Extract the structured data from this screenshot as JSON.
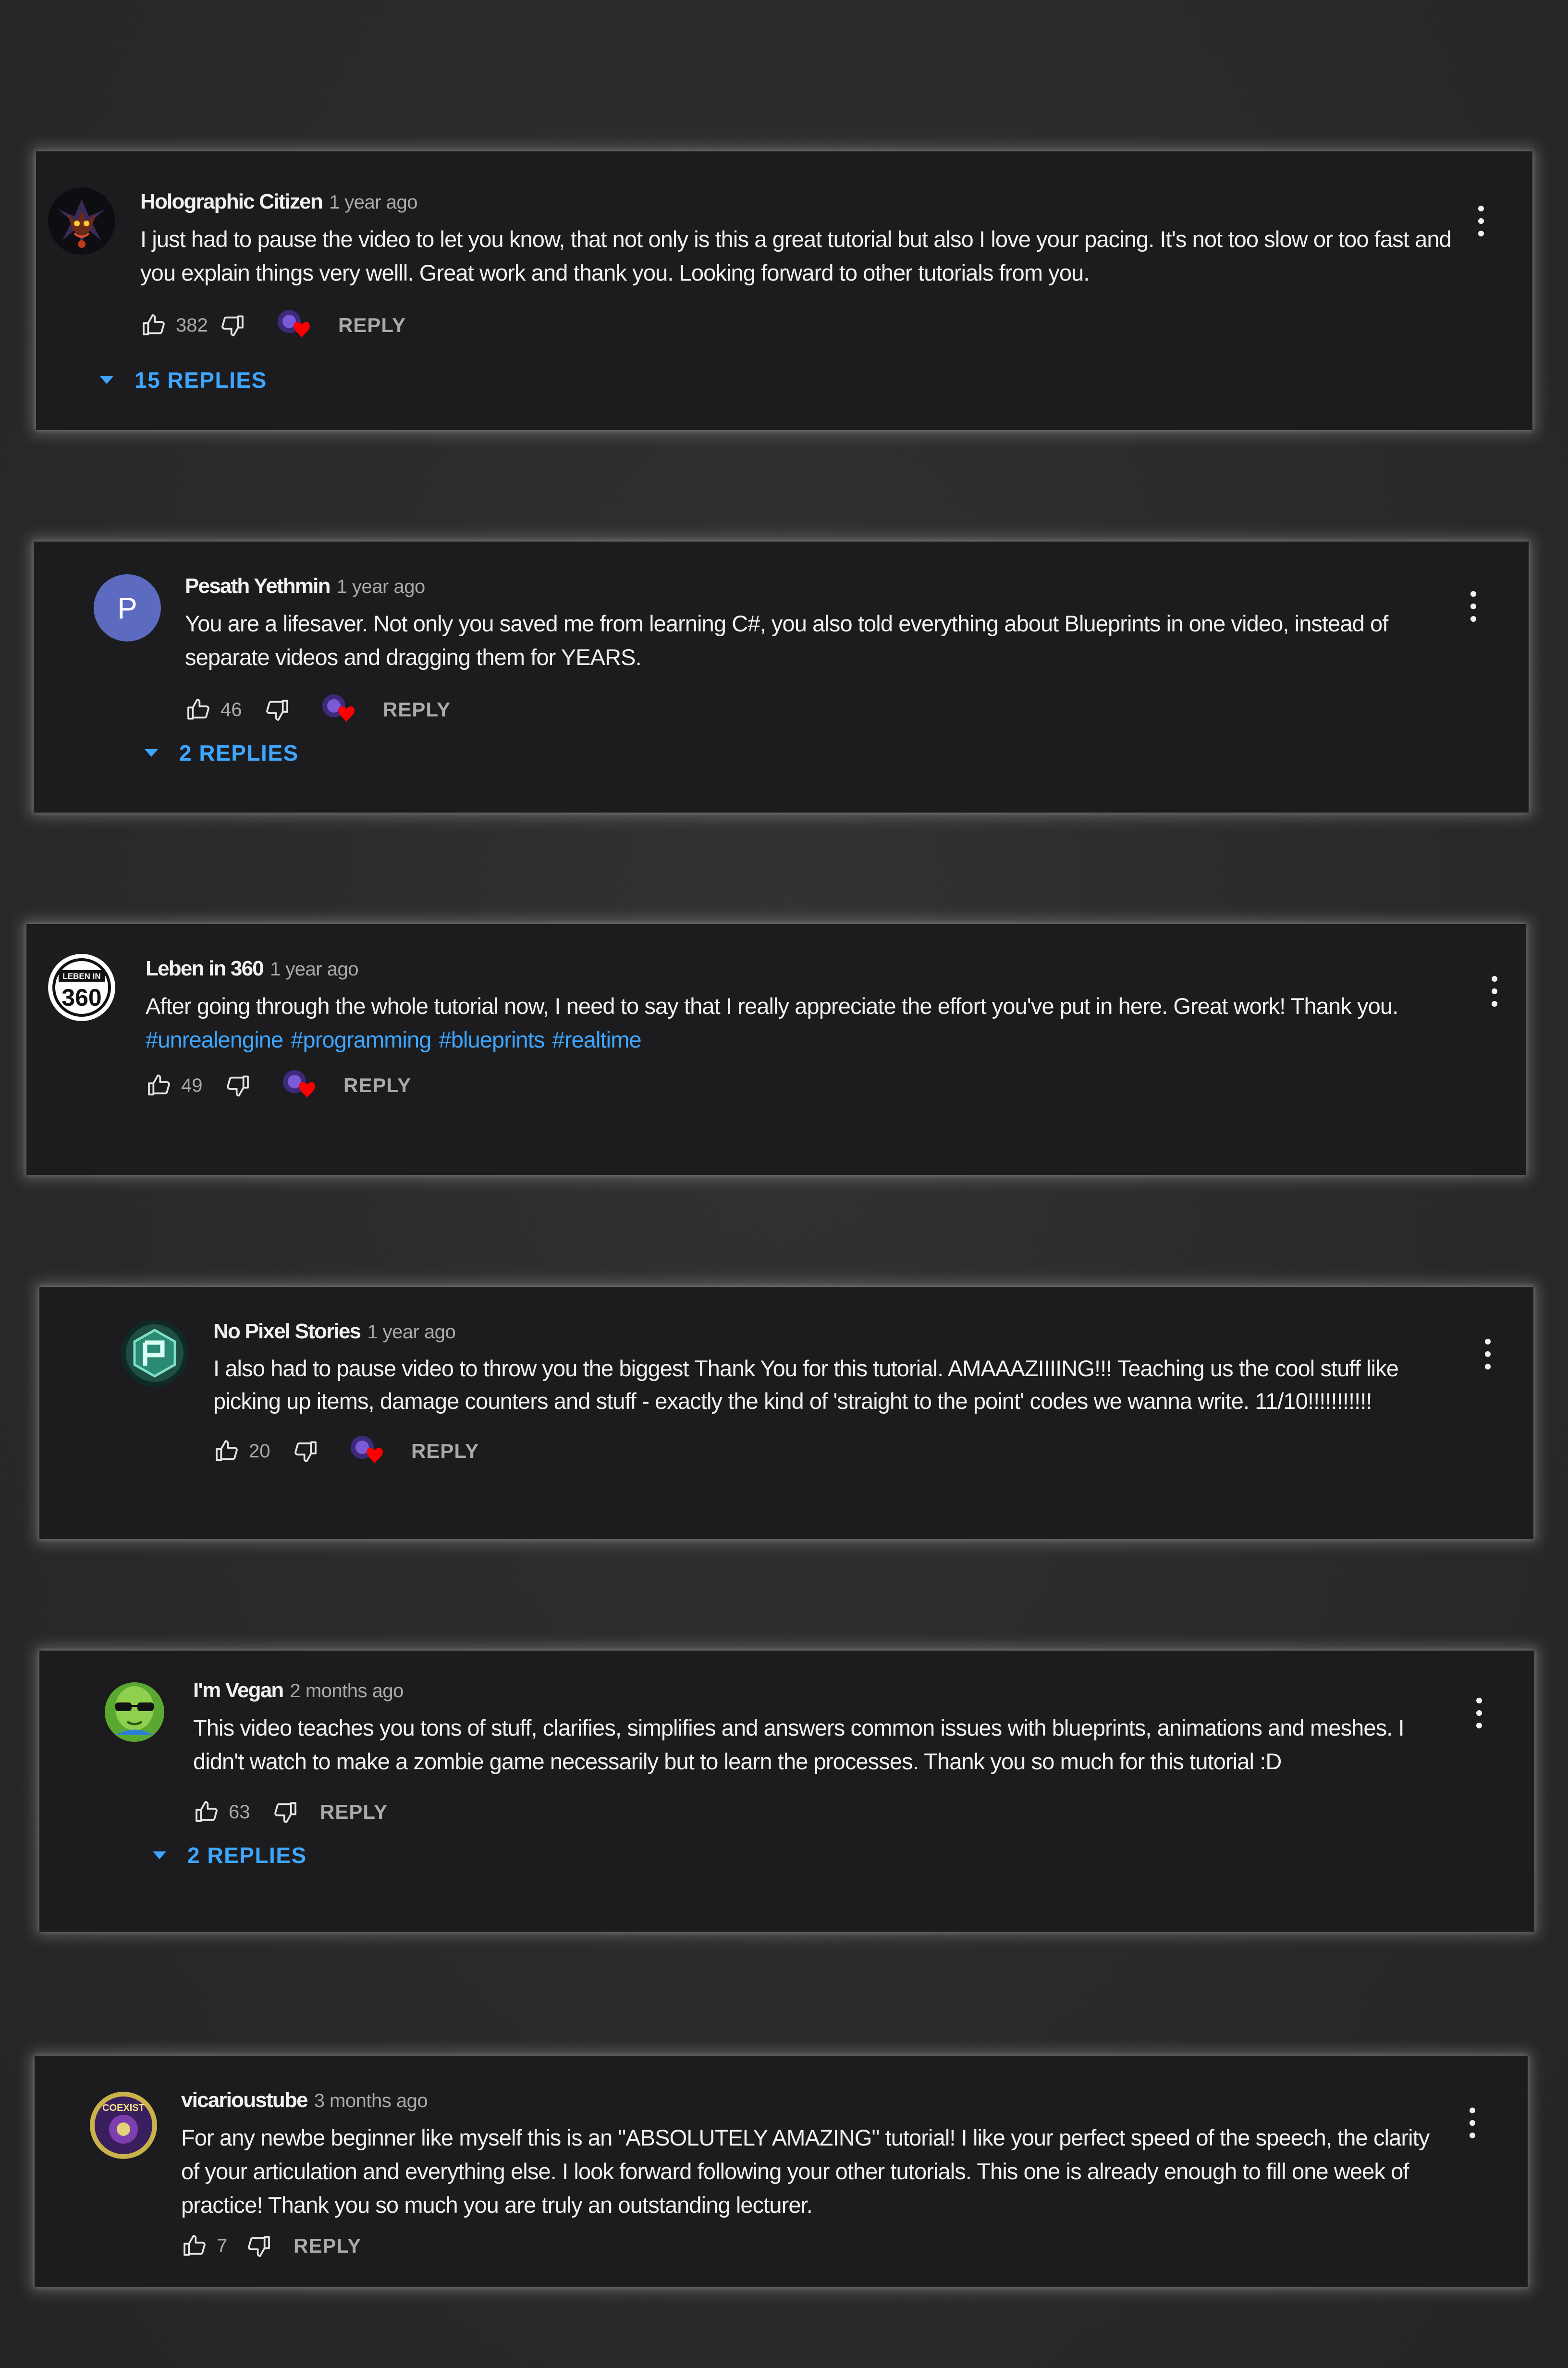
{
  "comments": [
    {
      "author": "Holographic Citizen",
      "time": "1 year ago",
      "text": "I just had to pause the video to let you know, that not only is this a great tutorial but also I love your pacing. It's not too slow or too fast and you explain things very welll. Great work and thank you. Looking forward to other tutorials from you.",
      "likes": "382",
      "reply_label": "REPLY",
      "replies_label": "15 REPLIES",
      "avatar_icon": "dark-creature-avatar-icon"
    },
    {
      "author": "Pesath Yethmin",
      "time": "1 year ago",
      "text": "You are a lifesaver. Not only you saved me from learning C#, you also told everything about Blueprints in one video, instead of separate videos and dragging them for YEARS.",
      "likes": "46",
      "reply_label": "REPLY",
      "replies_label": "2 REPLIES",
      "avatar_letter": "P",
      "avatar_color": "#5c6bc0"
    },
    {
      "author": "Leben in 360",
      "time": "1 year ago",
      "text": "After going through the whole tutorial now, I need to say that I really appreciate the effort you've put in here. Great work! Thank you.",
      "hashtags": [
        "#unrealengine",
        "#programming",
        "#blueprints",
        "#realtime"
      ],
      "likes": "49",
      "reply_label": "REPLY",
      "avatar_logo_top": "LEBEN IN",
      "avatar_logo_bottom": "360"
    },
    {
      "author": "No Pixel Stories",
      "time": "1 year ago",
      "text": "I also had to pause video to throw you the biggest Thank You for this tutorial. AMAAAZIIIING!!! Teaching us the cool stuff like picking up items, damage counters and stuff - exactly the kind of 'straight to the point' codes we wanna write. 11/10!!!!!!!!!!!",
      "likes": "20",
      "reply_label": "REPLY",
      "avatar_icon": "teal-cube-logo-icon"
    },
    {
      "author": "I'm Vegan",
      "time": "2 months ago",
      "text": "This video teaches you tons of stuff, clarifies, simplifies and answers common issues with blueprints, animations and meshes. I didn't watch to make a zombie game necessarily but to learn the processes. Thank you so much for this tutorial :D",
      "likes": "63",
      "reply_label": "REPLY",
      "replies_label": "2 REPLIES",
      "avatar_icon": "green-alien-icon"
    },
    {
      "author": "vicarioustube",
      "time": "3 months ago",
      "text": "For any newbe beginner like myself this is an \"ABSOLUTELY AMAZING\" tutorial! I like your perfect speed of the speech, the clarity of your articulation and everything else. I look forward following your other tutorials. This one is already enough to fill one week of practice! Thank you so much you are truly an outstanding lecturer.",
      "likes": "7",
      "reply_label": "REPLY",
      "avatar_logo_text": "COEXIST"
    }
  ],
  "colors": {
    "background": "#2b2b2b",
    "card": "#1c1c1e",
    "text": "#f1f1f1",
    "meta": "#aaaaaa",
    "link": "#3ea6ff",
    "heart": "#ff0000"
  },
  "icons": {
    "like": "thumbs-up-icon",
    "dislike": "thumbs-down-icon",
    "heart": "creator-heart-icon",
    "menu": "more-vert-icon",
    "expand": "caret-down-icon"
  }
}
